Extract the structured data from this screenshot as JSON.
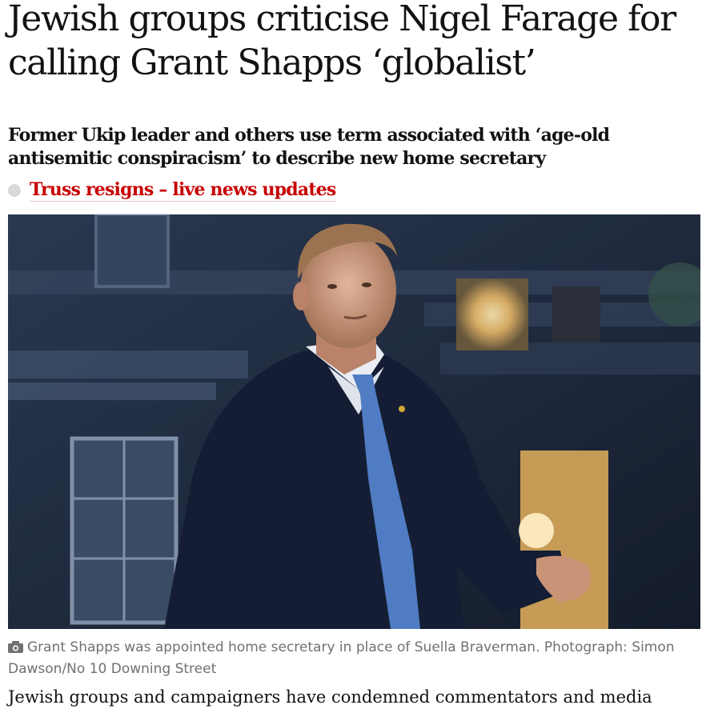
{
  "article": {
    "headline": "Jewish groups criticise Nigel Farage for calling Grant Shapps ‘globalist’",
    "standfirst": "Former Ukip leader and others use term associated with ‘age-old antisemitic conspiracism’ to describe new home secretary",
    "live_link": "Truss resigns – live news updates",
    "live_link_color": "#c70000",
    "image": {
      "description_icon": "camera-icon"
    },
    "caption": "Grant Shapps was appointed home secretary in place of Suella Braverman. Photograph: Simon Dawson/No 10 Downing Street",
    "body_first_line": "Jewish groups and campaigners have condemned commentators and media"
  }
}
